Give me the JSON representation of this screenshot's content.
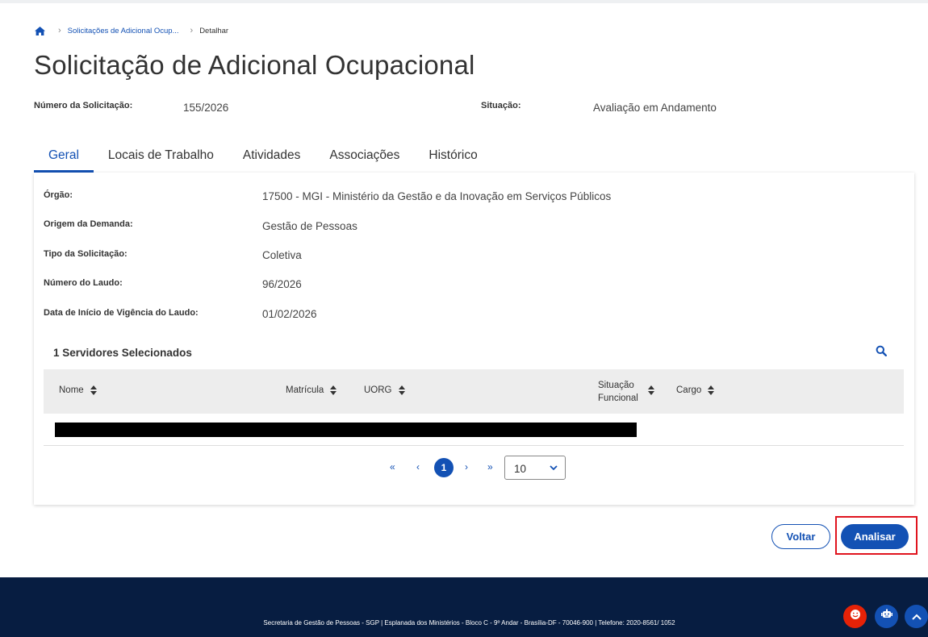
{
  "breadcrumb": {
    "items": [
      "Solicitações de Adicional Ocup...",
      "Detalhar"
    ]
  },
  "page": {
    "title": "Solicitação de Adicional Ocupacional"
  },
  "meta": {
    "numero_label": "Número da Solicitação:",
    "numero_value": "155/2026",
    "situacao_label": "Situação:",
    "situacao_value": "Avaliação em Andamento"
  },
  "tabs": [
    {
      "label": "Geral",
      "active": true
    },
    {
      "label": "Locais de Trabalho",
      "active": false
    },
    {
      "label": "Atividades",
      "active": false
    },
    {
      "label": "Associações",
      "active": false
    },
    {
      "label": "Histórico",
      "active": false
    }
  ],
  "details": [
    {
      "label": "Órgão:",
      "value": "17500 - MGI - Ministério da Gestão e da Inovação em Serviços Públicos"
    },
    {
      "label": "Origem da Demanda:",
      "value": "Gestão de Pessoas"
    },
    {
      "label": "Tipo da Solicitação:",
      "value": "Coletiva"
    },
    {
      "label": "Número do Laudo:",
      "value": "96/2026"
    },
    {
      "label": "Data de Início de Vigência do Laudo:",
      "value": "01/02/2026"
    }
  ],
  "servers": {
    "title": "1 Servidores Selecionados",
    "columns": {
      "nome": "Nome",
      "matricula": "Matrícula",
      "uorg": "UORG",
      "situacao_line1": "Situação",
      "situacao_line2": "Funcional",
      "cargo": "Cargo"
    }
  },
  "pagination": {
    "first": "«",
    "prev": "‹",
    "current": "1",
    "next": "›",
    "last": "»",
    "per_page": "10"
  },
  "actions": {
    "voltar": "Voltar",
    "analisar": "Analisar"
  },
  "footer": {
    "text": "Secretaria de Gestão de Pessoas - SGP | Esplanada dos Ministérios - Bloco C - 9º Andar - Brasília-DF - 70046-900 | Telefone: 2020-8561/ 1052"
  },
  "colors": {
    "primary": "#1351b4",
    "footer_bg": "#071d41",
    "highlight": "#e0141e",
    "fab_red": "#e52207"
  }
}
